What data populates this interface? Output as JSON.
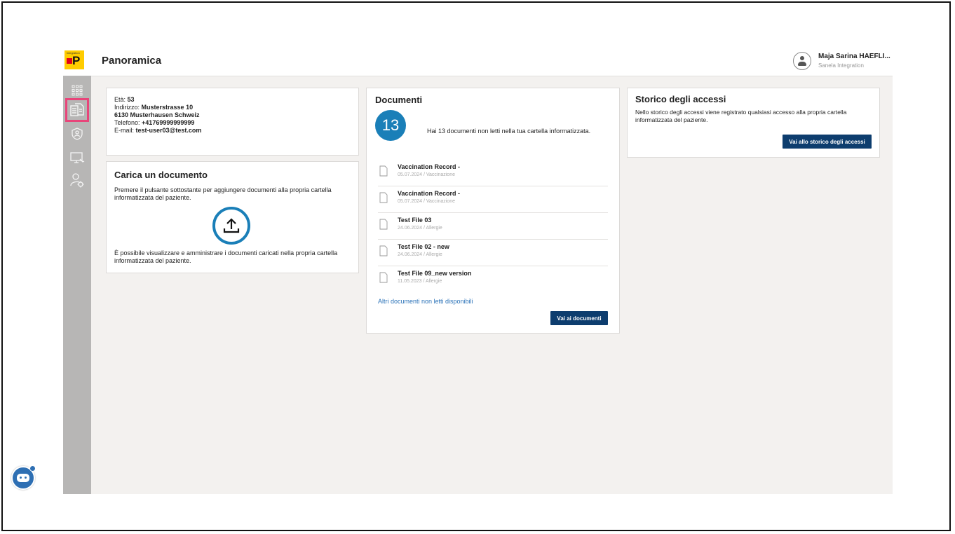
{
  "header": {
    "logo_text": "integration",
    "logo_letter": "P",
    "title": "Panoramica",
    "user_name": "Maja Sarina HAEFLI...",
    "user_org": "Sanela Integration"
  },
  "sidebar": {
    "items": [
      {
        "name": "overview",
        "icon": "grid-icon"
      },
      {
        "name": "documents",
        "icon": "documents-icon",
        "active": true
      },
      {
        "name": "access",
        "icon": "shield-user-icon"
      },
      {
        "name": "devices",
        "icon": "monitor-icon"
      },
      {
        "name": "settings",
        "icon": "user-settings-icon"
      }
    ]
  },
  "patient": {
    "age_label": "Età:",
    "age": "53",
    "address_label": "Indirizzo:",
    "address_line1": "Musterstrasse 10",
    "address_line2": "6130 Musterhausen Schweiz",
    "phone_label": "Telefono:",
    "phone": "+41769999999999",
    "email_label": "E-mail:",
    "email": "test-user03@test.com"
  },
  "upload": {
    "title": "Carica un documento",
    "text1": "Premere il pulsante sottostante per aggiungere documenti alla propria cartella informatizzata del paziente.",
    "text2": "È possibile visualizzare e amministrare i documenti caricati nella propria cartella informatizzata del paziente."
  },
  "documents": {
    "title": "Documenti",
    "count": "13",
    "summary": "Hai 13 documenti non letti nella tua cartella informatizzata.",
    "items": [
      {
        "title": "Vaccination Record -",
        "meta": "05.07.2024 / Vaccinazione"
      },
      {
        "title": "Vaccination Record -",
        "meta": "05.07.2024 / Vaccinazione"
      },
      {
        "title": "Test File 03",
        "meta": "24.06.2024 / Allergie"
      },
      {
        "title": "Test File 02 - new",
        "meta": "24.06.2024 / Allergie"
      },
      {
        "title": "Test File 09_new version",
        "meta": "11.05.2023 / Allergie"
      }
    ],
    "more_link": "Altri documenti non letti disponibili",
    "button": "Vai ai documenti"
  },
  "access_history": {
    "title": "Storico degli accessi",
    "text": "Nello storico degli accessi viene registrato qualsiasi accesso alla propria cartella informatizzata del paziente.",
    "button": "Vai allo storico degli accessi"
  },
  "colors": {
    "accent": "#1a7fb8",
    "button": "#0d3d6e",
    "highlight": "#e8457a",
    "sidebar": "#b7b6b5"
  }
}
